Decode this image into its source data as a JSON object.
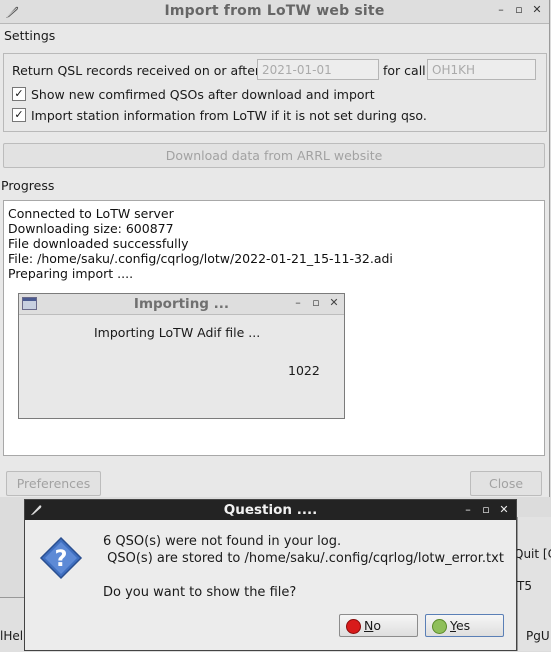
{
  "window": {
    "title": "Import from LoTW web site",
    "controls": [
      "–",
      "▫",
      "✕"
    ]
  },
  "settings": {
    "heading": "Settings",
    "return_label": "Return QSL records received on or after",
    "date_placeholder": "2021-01-01",
    "for_call_label": "for call",
    "call_placeholder": "OH1KH",
    "show_new_checked": true,
    "show_new_label": "Show new comfirmed QSOs after download and import",
    "import_station_checked": true,
    "import_station_label": "Import station information from LoTW if it is not set during qso."
  },
  "download_button": "Download data from ARRL website",
  "progress": {
    "heading": "Progress",
    "lines": [
      "Connected to LoTW server",
      "Downloading size: 600877",
      "File downloaded successfully",
      "File: /home/saku/.config/cqrlog/lotw/2022-01-21_15-11-32.adi",
      "Preparing import ...."
    ]
  },
  "importing": {
    "title": "Importing ...",
    "message": "Importing LoTW Adif file ...",
    "count": "1022",
    "controls": [
      "–",
      "▫",
      "✕"
    ]
  },
  "footer": {
    "preferences": "Preferences",
    "close": "Close"
  },
  "background_fragments": {
    "quit": "Quit [C",
    "t5": "T5",
    "lhel": "lHel",
    "pgu": "PgU"
  },
  "question": {
    "title": "Question ....",
    "line1": "6 QSO(s) were not found in your log.",
    "line2": " QSO(s) are stored to /home/saku/.config/cqrlog/lotw_error.txt",
    "line3": "Do you want to show the file?",
    "no_label": "No",
    "no_mnemonic": "N",
    "no_rest": "o",
    "yes_label": "Yes",
    "yes_mnemonic": "Y",
    "yes_rest": "es",
    "controls": [
      "–",
      "▫",
      "✕"
    ]
  },
  "colors": {
    "no_icon": "#d81b1b",
    "yes_icon": "#8fbf5a",
    "question_icon": "#3f6fc0"
  }
}
